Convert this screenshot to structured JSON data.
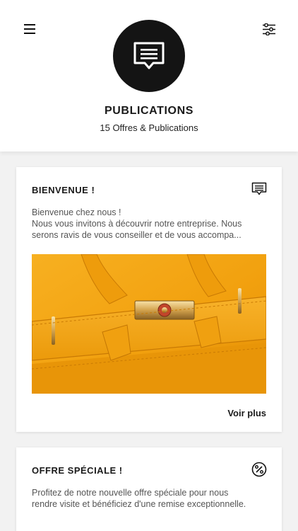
{
  "header": {
    "title": "PUBLICATIONS",
    "subtitle": "15 Offres & Publications",
    "menu_icon": "hamburger-menu-icon",
    "filter_icon": "sliders-filter-icon",
    "hero_icon": "message-icon"
  },
  "cards": [
    {
      "title": "BIENVENUE !",
      "icon": "message-icon",
      "text_lines": [
        "Bienvenue chez nous !",
        "Nous vous invitons à découvrir notre entreprise. Nous",
        "serons ravis de vous conseiller et de vous accompa..."
      ],
      "image": "orange-leather-handbag-photo",
      "link_label": "Voir plus"
    },
    {
      "title": "OFFRE SPÉCIALE !",
      "icon": "percent-badge-icon",
      "text_lines": [
        "Profitez de notre nouvelle offre spéciale pour nous",
        "rendre visite et bénéficiez d'une remise exceptionnelle."
      ]
    }
  ],
  "colors": {
    "background": "#f2f2f2",
    "card": "#ffffff",
    "accent_dark": "#141414",
    "leather": "#f2a10f"
  }
}
